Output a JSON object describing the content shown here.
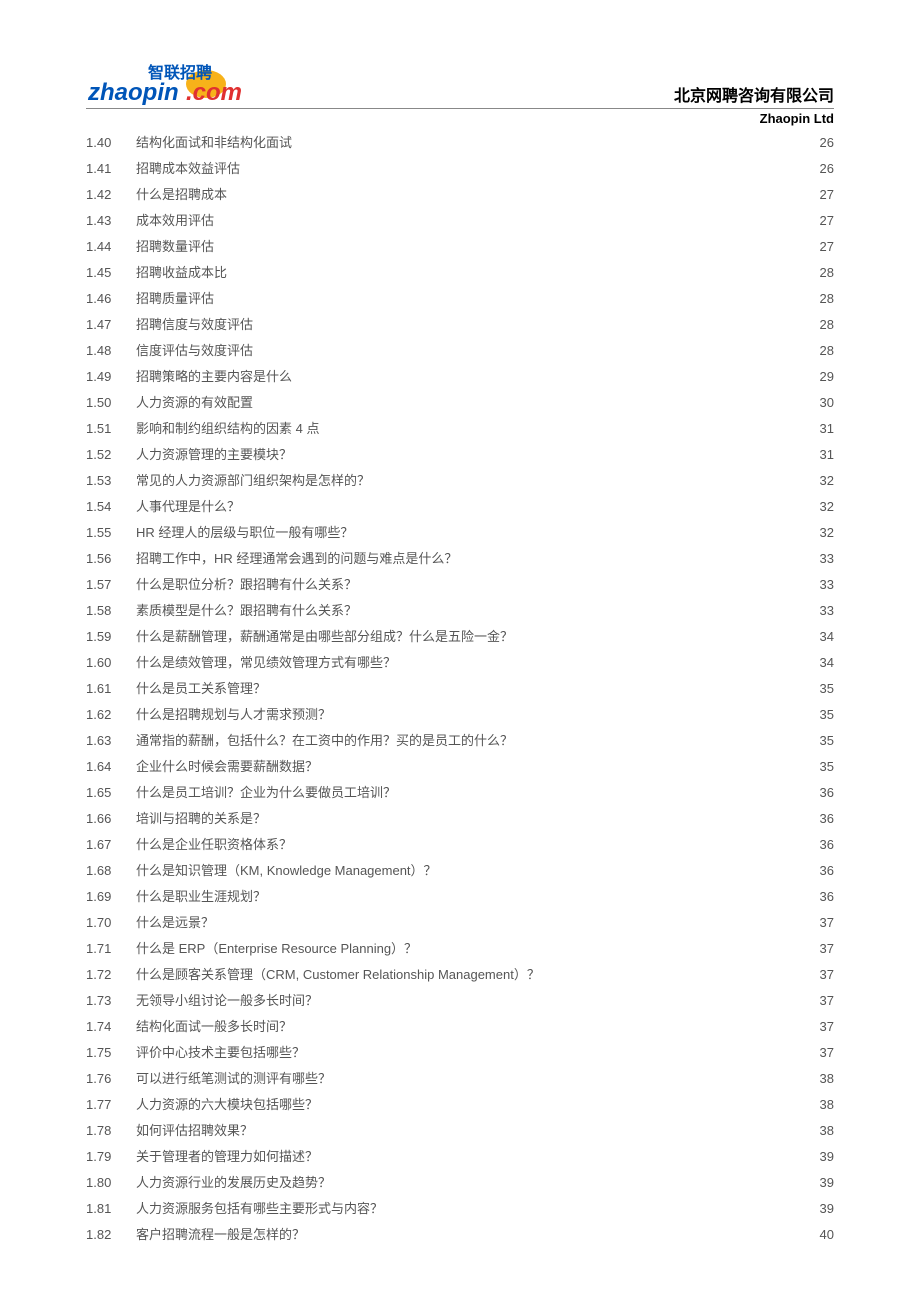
{
  "header": {
    "company_cn": "北京网聘咨询有限公司",
    "company_en": "Zhaopin Ltd",
    "logo_text_top": "智联招聘",
    "logo_text_main": "zhaopin",
    "logo_text_tld": ".com"
  },
  "toc": [
    {
      "num": "1.40",
      "title": "结构化面试和非结构化面试",
      "page": "26"
    },
    {
      "num": "1.41",
      "title": "招聘成本效益评估",
      "page": "26"
    },
    {
      "num": "1.42",
      "title": "什么是招聘成本",
      "page": "27"
    },
    {
      "num": "1.43",
      "title": "成本效用评估",
      "page": "27"
    },
    {
      "num": "1.44",
      "title": "招聘数量评估",
      "page": "27"
    },
    {
      "num": "1.45",
      "title": "招聘收益成本比",
      "page": "28"
    },
    {
      "num": "1.46",
      "title": "招聘质量评估",
      "page": "28"
    },
    {
      "num": "1.47",
      "title": "招聘信度与效度评估",
      "page": "28"
    },
    {
      "num": "1.48",
      "title": "信度评估与效度评估",
      "page": "28"
    },
    {
      "num": "1.49",
      "title": "招聘策略的主要内容是什么",
      "page": "29"
    },
    {
      "num": "1.50",
      "title": "人力资源的有效配置",
      "page": "30"
    },
    {
      "num": "1.51",
      "title": "影响和制约组织结构的因素 4 点",
      "page": "31"
    },
    {
      "num": "1.52",
      "title": "人力资源管理的主要模块？",
      "page": "31"
    },
    {
      "num": "1.53",
      "title": "常见的人力资源部门组织架构是怎样的？",
      "page": "32"
    },
    {
      "num": "1.54",
      "title": "人事代理是什么？",
      "page": "32"
    },
    {
      "num": "1.55",
      "title": "HR 经理人的层级与职位一般有哪些？",
      "page": "32"
    },
    {
      "num": "1.56",
      "title": "招聘工作中，HR 经理通常会遇到的问题与难点是什么？",
      "page": "33"
    },
    {
      "num": "1.57",
      "title": "什么是职位分析？跟招聘有什么关系？",
      "page": "33"
    },
    {
      "num": "1.58",
      "title": "素质模型是什么？跟招聘有什么关系？",
      "page": "33"
    },
    {
      "num": "1.59",
      "title": "什么是薪酬管理，薪酬通常是由哪些部分组成？什么是五险一金？",
      "page": "34"
    },
    {
      "num": "1.60",
      "title": "什么是绩效管理，常见绩效管理方式有哪些？",
      "page": "34"
    },
    {
      "num": "1.61",
      "title": "什么是员工关系管理？",
      "page": "35"
    },
    {
      "num": "1.62",
      "title": "什么是招聘规划与人才需求预测？",
      "page": "35"
    },
    {
      "num": "1.63",
      "title": "通常指的薪酬，包括什么？在工资中的作用？买的是员工的什么？",
      "page": "35"
    },
    {
      "num": "1.64",
      "title": "企业什么时候会需要薪酬数据？",
      "page": "35"
    },
    {
      "num": "1.65",
      "title": "什么是员工培训？企业为什么要做员工培训？",
      "page": "36"
    },
    {
      "num": "1.66",
      "title": "培训与招聘的关系是？",
      "page": "36"
    },
    {
      "num": "1.67",
      "title": "什么是企业任职资格体系？",
      "page": "36"
    },
    {
      "num": "1.68",
      "title": "什么是知识管理（KM, Knowledge Management）？",
      "page": "36"
    },
    {
      "num": "1.69",
      "title": "什么是职业生涯规划？",
      "page": "36"
    },
    {
      "num": "1.70",
      "title": "什么是远景？",
      "page": "37"
    },
    {
      "num": "1.71",
      "title": "什么是 ERP（Enterprise Resource Planning）？",
      "page": "37"
    },
    {
      "num": "1.72",
      "title": "什么是顾客关系管理（CRM, Customer Relationship Management）？",
      "page": "37"
    },
    {
      "num": "1.73",
      "title": "无领导小组讨论一般多长时间？",
      "page": "37"
    },
    {
      "num": "1.74",
      "title": "结构化面试一般多长时间？",
      "page": "37"
    },
    {
      "num": "1.75",
      "title": "评价中心技术主要包括哪些？",
      "page": "37"
    },
    {
      "num": "1.76",
      "title": "可以进行纸笔测试的测评有哪些？",
      "page": "38"
    },
    {
      "num": "1.77",
      "title": "人力资源的六大模块包括哪些？",
      "page": "38"
    },
    {
      "num": "1.78",
      "title": "如何评估招聘效果？",
      "page": "38"
    },
    {
      "num": "1.79",
      "title": "关于管理者的管理力如何描述？",
      "page": "39"
    },
    {
      "num": "1.80",
      "title": "人力资源行业的发展历史及趋势？",
      "page": "39"
    },
    {
      "num": "1.81",
      "title": "人力资源服务包括有哪些主要形式与内容？",
      "page": "39"
    },
    {
      "num": "1.82",
      "title": "客户招聘流程一般是怎样的？",
      "page": "40"
    }
  ]
}
